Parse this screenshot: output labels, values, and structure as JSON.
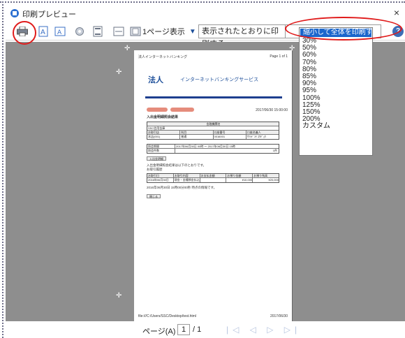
{
  "window": {
    "title": "印刷プレビュー",
    "close_glyph": "×"
  },
  "toolbar": {
    "pages_per_view": "1ページ表示",
    "print_mode": "表示されたとおりに印刷する",
    "help_glyph": "?"
  },
  "scale_dropdown": {
    "options": [
      "縮小して全体を印刷する",
      "30%",
      "50%",
      "60%",
      "70%",
      "80%",
      "85%",
      "90%",
      "95%",
      "100%",
      "125%",
      "150%",
      "200%",
      "カスタム"
    ],
    "selected": "縮小して全体を印刷する"
  },
  "page": {
    "header_left": "法人インターネットバンキング",
    "header_right": "Page 1 of 1",
    "brand_logo": "法人",
    "brand_sub": "インターネットバンキングサービス",
    "date": "2017/06/30 15:00:00",
    "title": "入出金明細照会結果",
    "account_table": {
      "title": "金融機関名",
      "bank": "SSC信用金庫",
      "headers": [
        "お取引店",
        "科目",
        "口座番号",
        "口座名義人"
      ],
      "row": [
        "本店(001)",
        "普通",
        "0016001",
        "ｻｸﾗﾃﾞﾝｷ ｺｳｷﾞｮｳ"
      ]
    },
    "period_label": "照会期間",
    "period_value": "2017年06月30日 00時 ～ 2017年06月30日 15時",
    "kind_label": "照会件数",
    "kind_value": "1件",
    "detail_button": "入出金明細",
    "result_text": "入出金明細照会結果は以下のとおりです。",
    "result_sub": "お取引履歴",
    "detail_headers": [
      "お取引日",
      "お取引内容",
      "お支払金額",
      "お預り金額",
      "お預り残高"
    ],
    "detail_row": [
      "2016年06月30日",
      "現金・金種預金払込",
      "",
      "¥10,000",
      "¥20,000"
    ],
    "note": "2016年06月30日 15時00分00秒 時点の情報です。",
    "back_button": "閉じる",
    "footer_left": "file:///C:/Users/SSC/Desktop/test.html",
    "footer_right": "2017/06/30"
  },
  "status": {
    "page_label": "ページ(A)",
    "page_current": "1",
    "page_total": "/ 1",
    "nav_glyphs": "|◁ ◁ ▷ ▷|"
  }
}
